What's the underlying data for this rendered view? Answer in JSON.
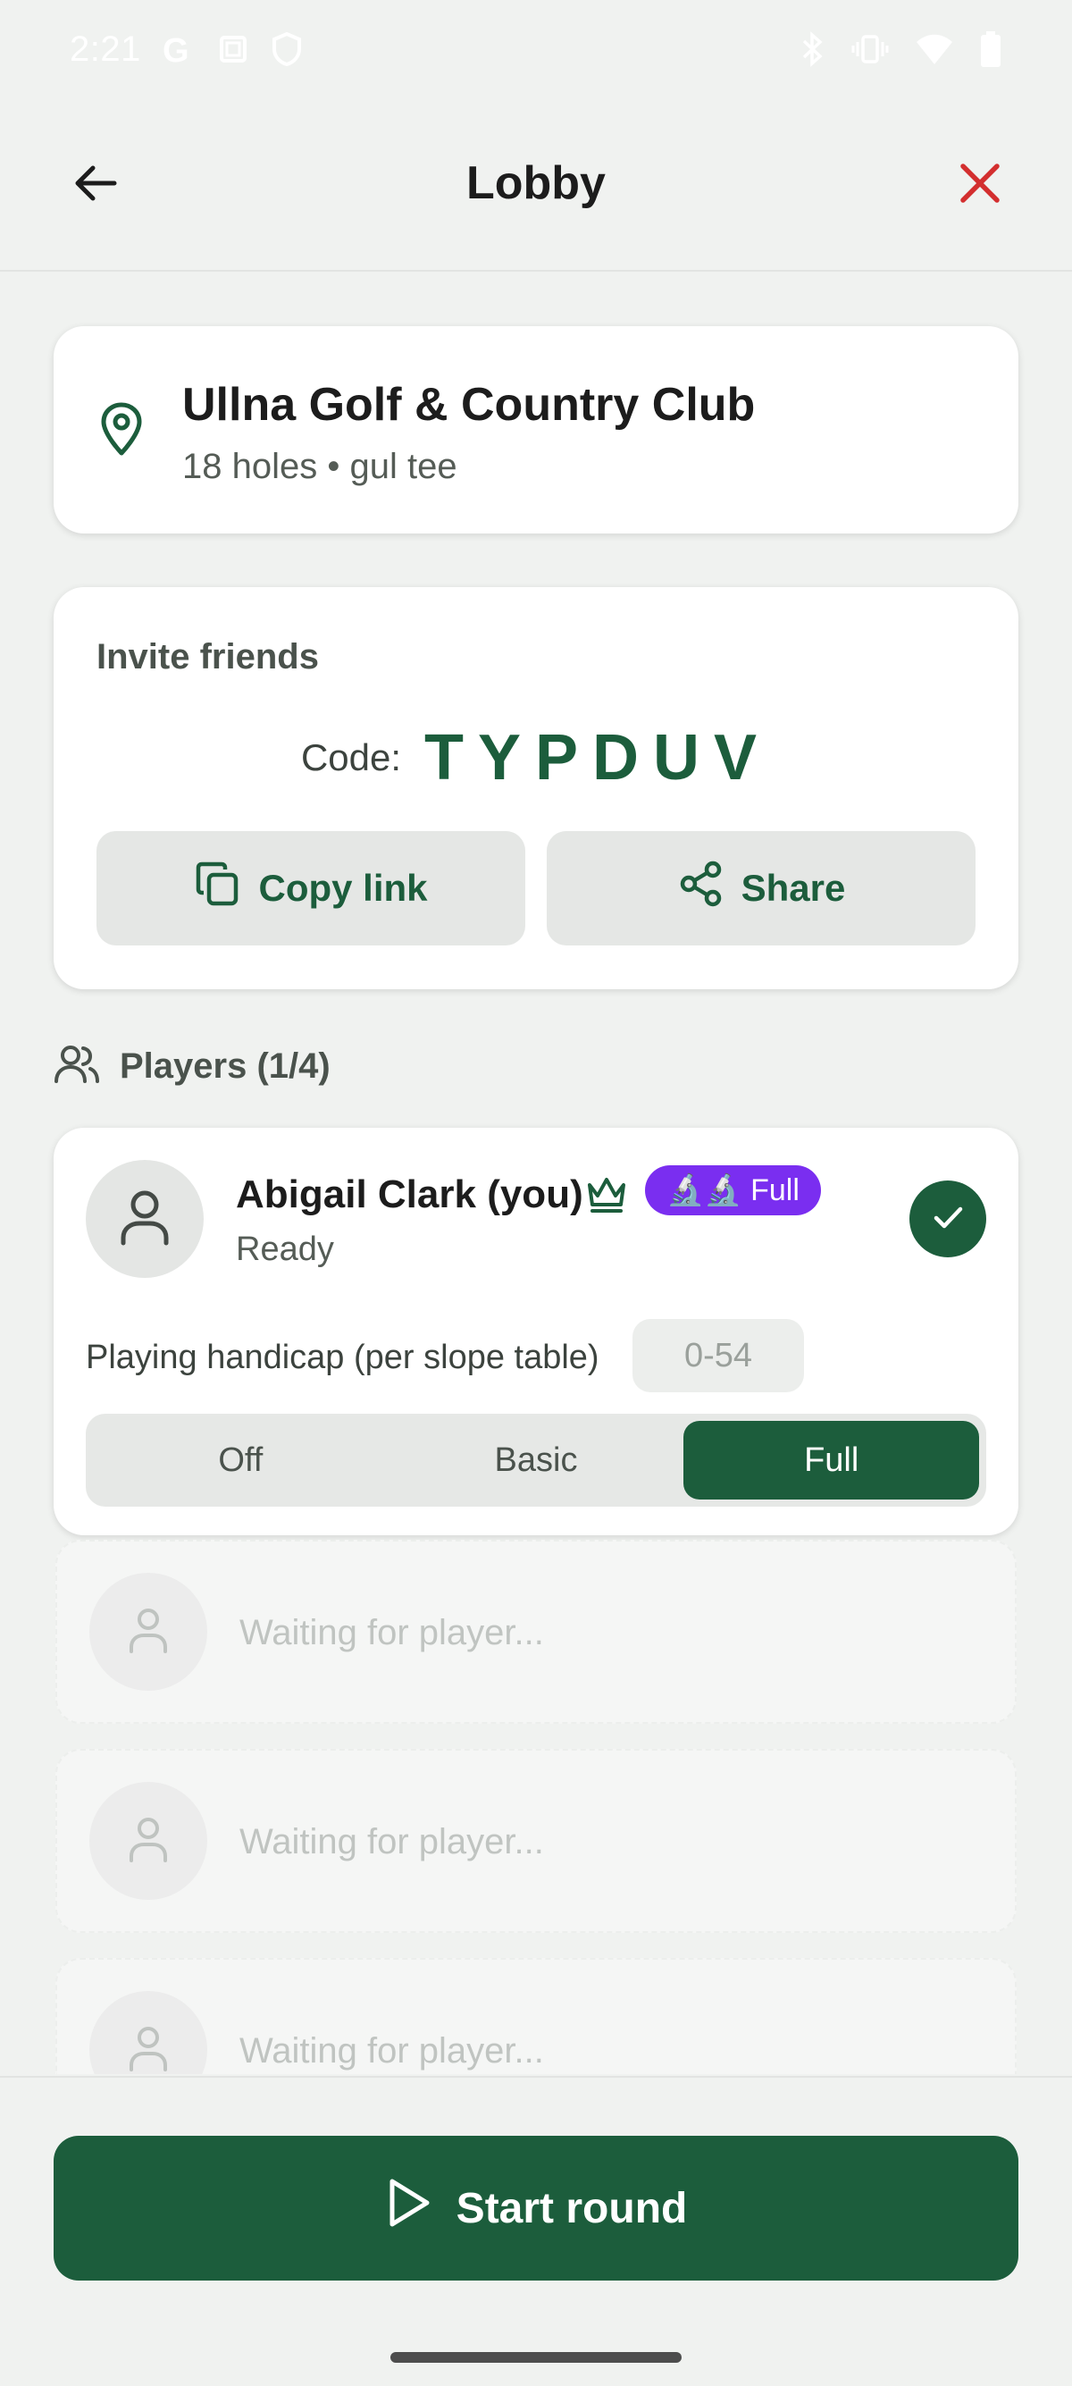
{
  "status_bar": {
    "time": "2:21",
    "left_icons": [
      "google-icon",
      "screenshot-icon",
      "shield-icon"
    ],
    "right_icons": [
      "bluetooth-icon",
      "vibrate-icon",
      "wifi-icon",
      "battery-icon"
    ]
  },
  "app_bar": {
    "title": "Lobby",
    "back_icon": "arrow-left-icon",
    "close_icon": "close-icon"
  },
  "course": {
    "name": "Ullna Golf & Country Club",
    "meta": "18 holes • gul tee"
  },
  "invite": {
    "title": "Invite friends",
    "code_label": "Code:",
    "code": "TYPDUV",
    "copy_label": "Copy link",
    "share_label": "Share"
  },
  "players": {
    "title": "Players (1/4)",
    "list": [
      {
        "name": "Abigail Clark (you)",
        "status": "Ready",
        "badge": "🔬🔬 Full",
        "handicap_label": "Playing handicap (per slope table)",
        "handicap_placeholder": "0-54",
        "modes": [
          "Off",
          "Basic",
          "Full"
        ],
        "selected_mode": "Full"
      }
    ],
    "waiting_text": "Waiting for player...",
    "waiting": [
      "Waiting for player...",
      "Waiting for player...",
      "Waiting for player..."
    ]
  },
  "actions": {
    "start_label": "Start round"
  },
  "colors": {
    "primary": "#1c5d3c",
    "danger": "#d32f2f",
    "badge": "#7a2ef0",
    "background": "#f0f2f0"
  }
}
